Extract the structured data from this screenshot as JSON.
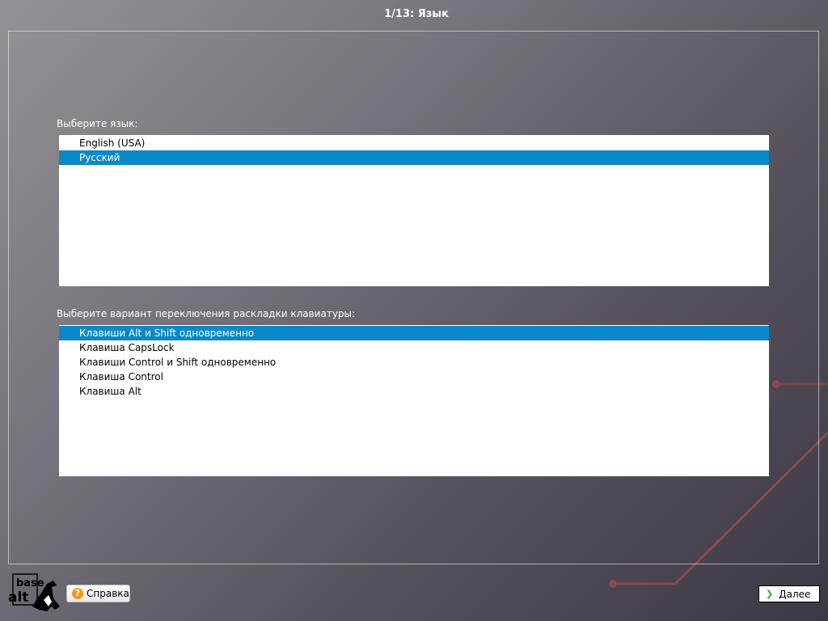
{
  "header": {
    "title": "1/13: Язык"
  },
  "language": {
    "label": "Выберите язык:",
    "items": [
      "English (USA)",
      "Русский"
    ],
    "selected": 1
  },
  "layout_switch": {
    "label": "Выберите вариант переключения раскладки клавиатуры:",
    "items": [
      "Клавиши Alt и Shift одновременно",
      "Клавиша CapsLock",
      "Клавиши Control и Shift одновременно",
      "Клавиша Control",
      "Клавиша Alt"
    ],
    "selected": 0
  },
  "footer": {
    "logo_text": "base alt",
    "help_label": "Справка",
    "next_label": "Далее"
  },
  "colors": {
    "selection": "#0a88c7",
    "accent_line": "#8a4a48"
  }
}
